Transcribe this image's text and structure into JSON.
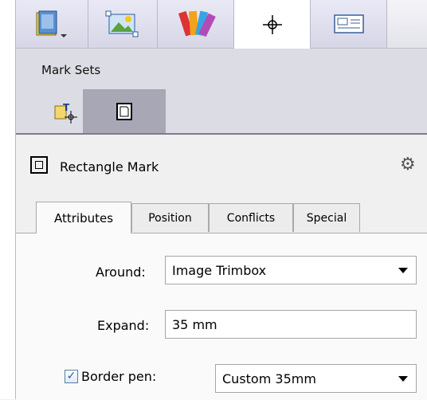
{
  "top_tabs": [
    {
      "icon": "document-book-icon"
    },
    {
      "icon": "image-crop-icon"
    },
    {
      "icon": "color-swatches-icon"
    },
    {
      "icon": "crosshair-mark-icon",
      "active": true
    },
    {
      "icon": "layout-frame-icon"
    }
  ],
  "mark_sets": {
    "title": "Mark Sets",
    "tabs": [
      {
        "icon": "text-mark-icon"
      },
      {
        "icon": "page-mark-icon",
        "active": true
      }
    ]
  },
  "mark": {
    "title": "Rectangle Mark"
  },
  "sub_tabs": [
    "Attributes",
    "Position",
    "Conflicts",
    "Special"
  ],
  "form": {
    "around_label": "Around:",
    "around_value": "Image Trimbox",
    "expand_label": "Expand:",
    "expand_value": "35 mm",
    "border_pen_label": "Border pen:",
    "border_pen_checked": true,
    "border_pen_value": "Custom 35mm"
  },
  "colors": {
    "active_tab": "#ffffff",
    "mark_sets_bg": "#dcdce4",
    "selected_set_tab": "#a7a7b6"
  }
}
